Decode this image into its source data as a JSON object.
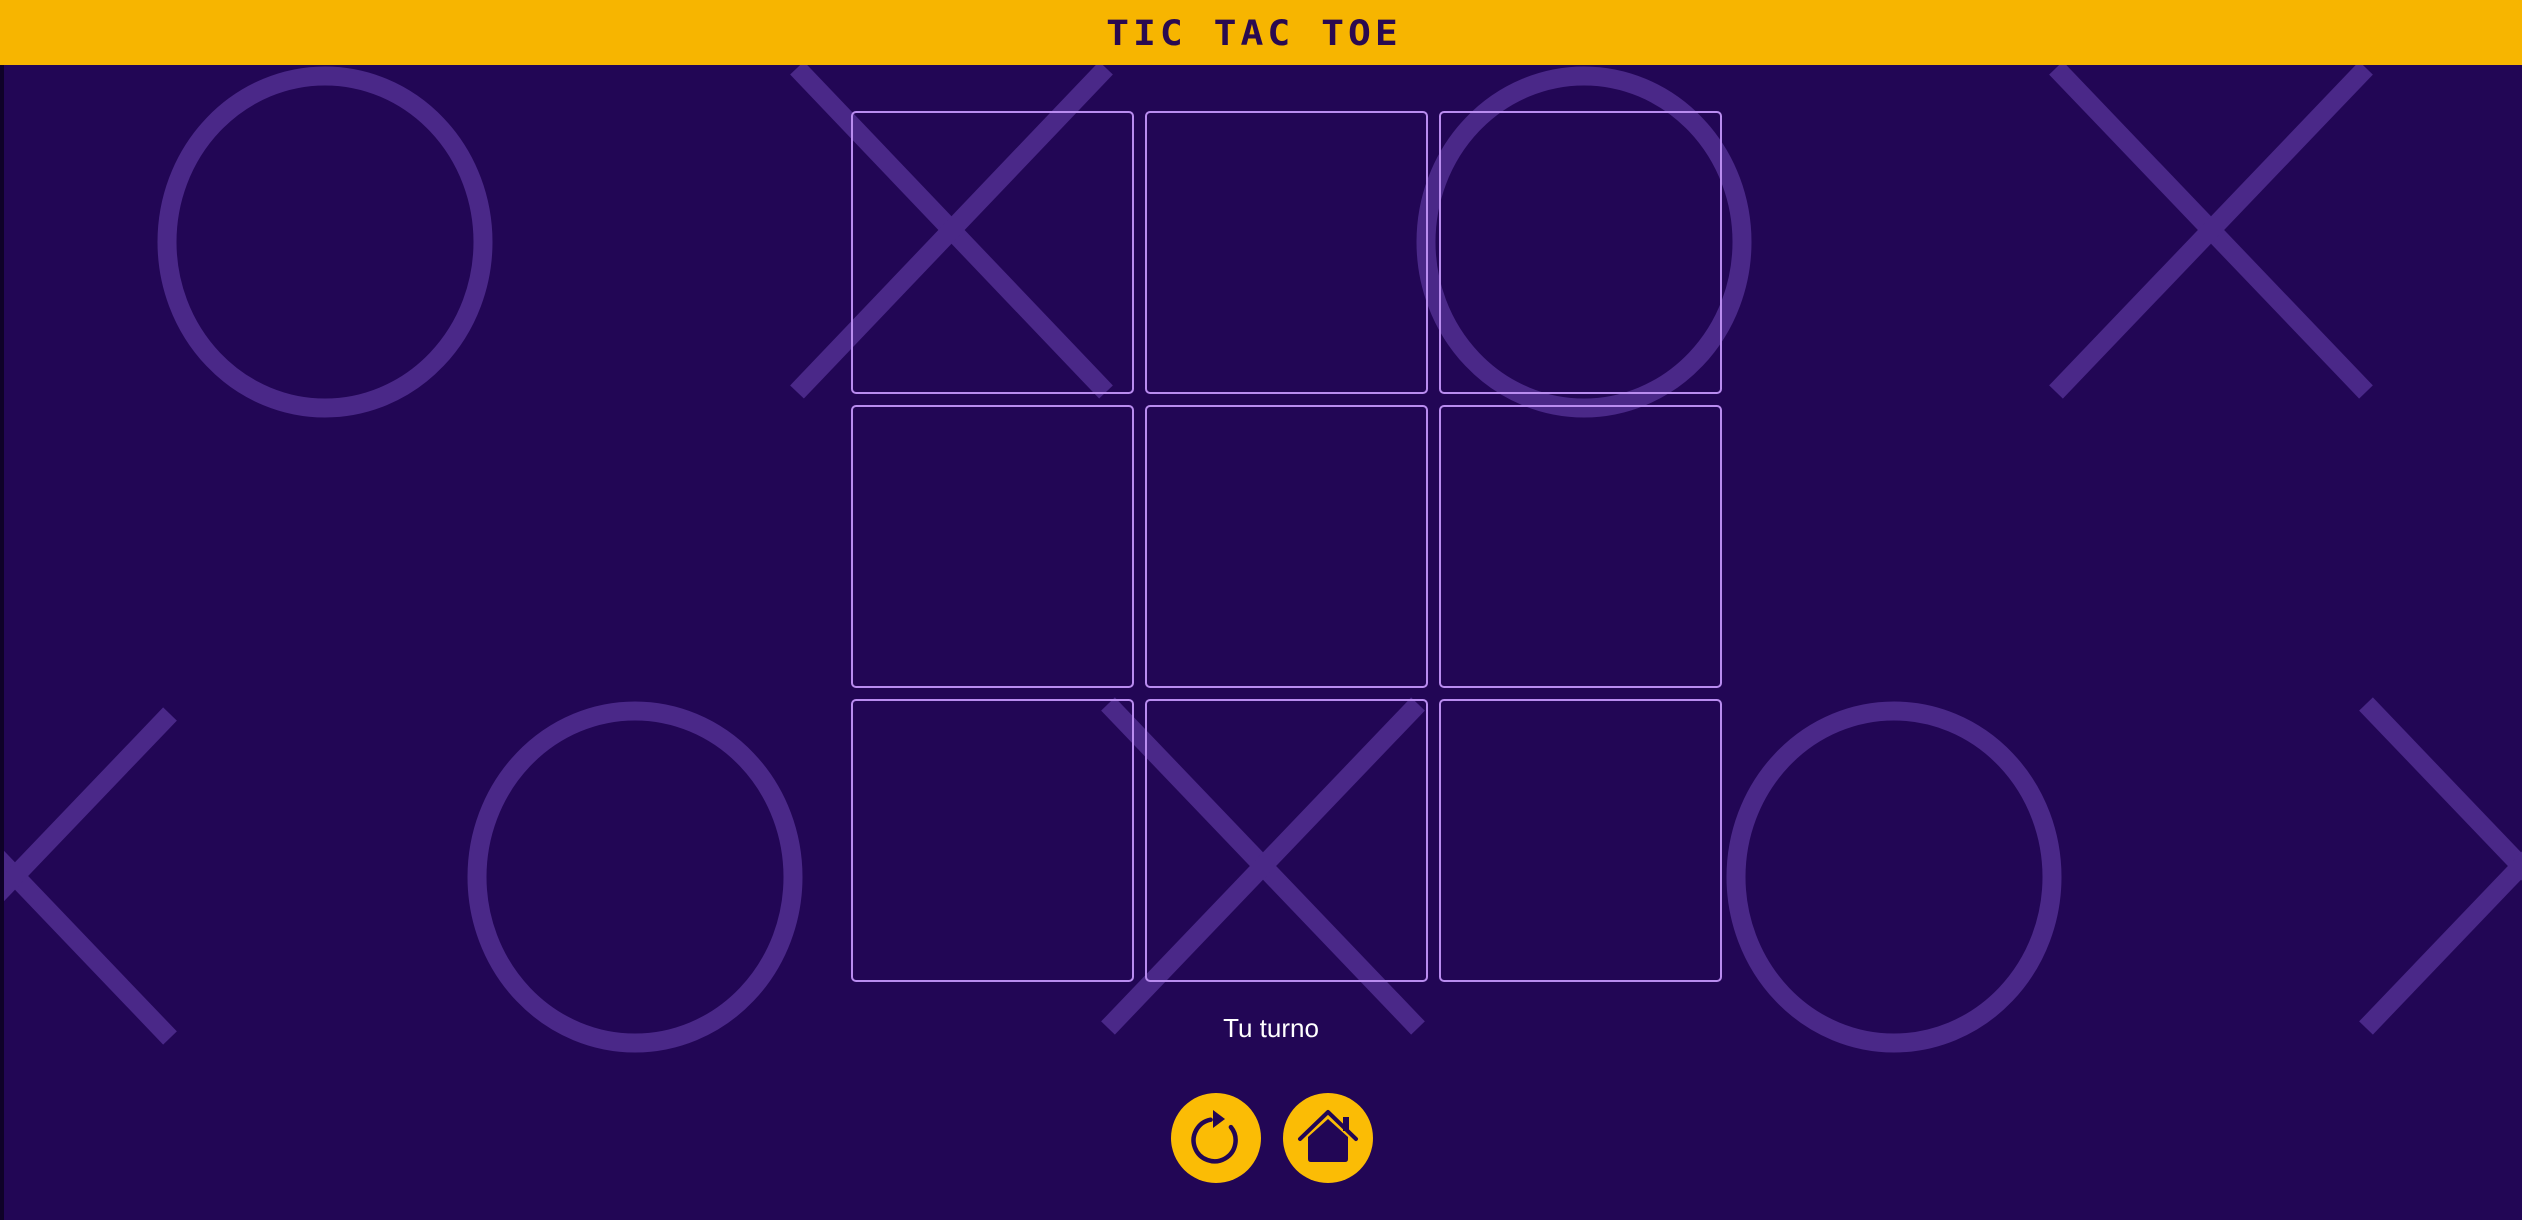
{
  "header": {
    "title": "TIC TAC TOE"
  },
  "game": {
    "board": [
      "",
      "",
      "",
      "",
      "",
      "",
      "",
      "",
      ""
    ],
    "status_text": "Tu turno"
  },
  "controls": {
    "restart_icon": "restart-icon",
    "home_icon": "home-icon"
  },
  "theme": {
    "background": "#220655",
    "header": "#f7b500",
    "cell_border": "#b98cf0",
    "button": "#fbbc05",
    "decor": "#4a2888"
  }
}
